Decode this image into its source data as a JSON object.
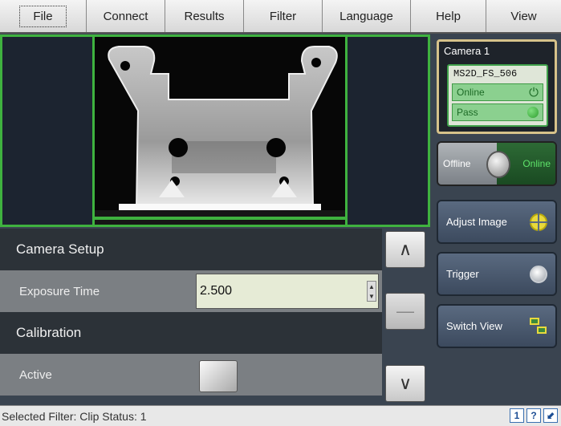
{
  "menu": {
    "items": [
      {
        "label": "File"
      },
      {
        "label": "Connect"
      },
      {
        "label": "Results"
      },
      {
        "label": "Filter"
      },
      {
        "label": "Language"
      },
      {
        "label": "Help"
      },
      {
        "label": "View"
      }
    ]
  },
  "camera": {
    "title": "Camera 1",
    "model": "MS2D_FS_506",
    "online_label": "Online",
    "pass_label": "Pass",
    "online_icon": "power-icon",
    "pass_color": "#3fb23f"
  },
  "toggle": {
    "off_label": "Offline",
    "on_label": "Online"
  },
  "side_buttons": {
    "adjust_label": "Adjust Image",
    "trigger_label": "Trigger",
    "switch_label": "Switch View"
  },
  "settings": {
    "camera_setup_header": "Camera Setup",
    "exposure_label": "Exposure Time",
    "exposure_value": "2.500",
    "calibration_header": "Calibration",
    "active_label": "Active"
  },
  "status": {
    "text": "Selected Filter: Clip  Status: 1"
  },
  "colors": {
    "accent_green": "#3fb23f",
    "panel_bg": "#3a4450",
    "header_bg": "#2c3238",
    "row_bg": "#7b7f83"
  }
}
